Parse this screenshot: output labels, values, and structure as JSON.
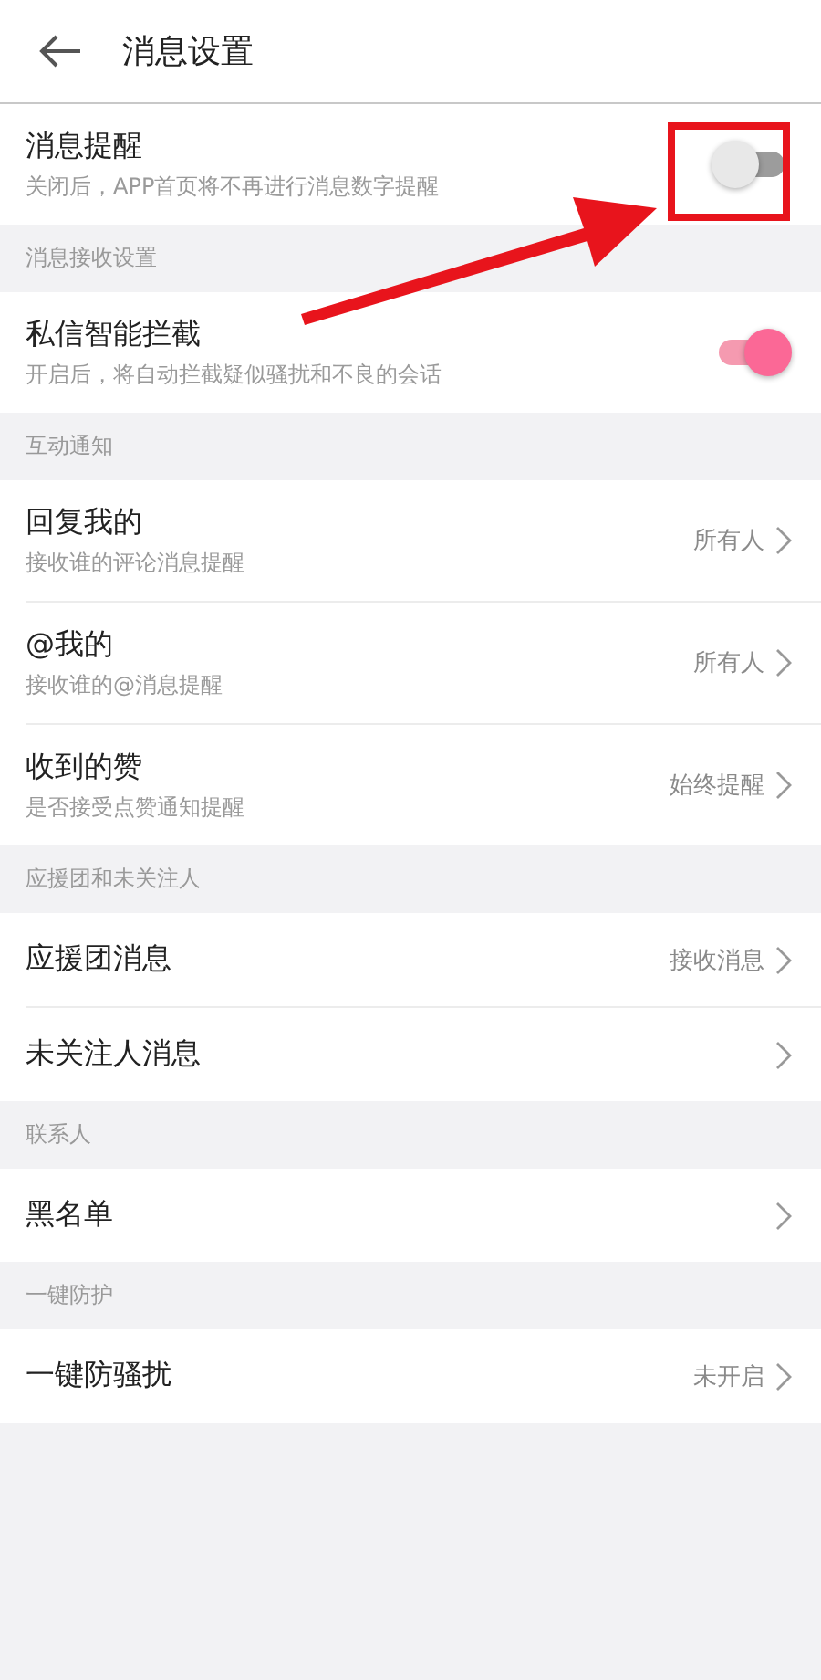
{
  "title": "消息设置",
  "sections": [
    {
      "items": [
        {
          "kind": "toggle",
          "title": "消息提醒",
          "subtitle": "关闭后，APP首页将不再进行消息数字提醒",
          "on": false
        }
      ]
    },
    {
      "header": "消息接收设置",
      "items": [
        {
          "kind": "toggle",
          "title": "私信智能拦截",
          "subtitle": "开启后，将自动拦截疑似骚扰和不良的会话",
          "on": true
        }
      ]
    },
    {
      "header": "互动通知",
      "items": [
        {
          "kind": "link",
          "title": "回复我的",
          "subtitle": "接收谁的评论消息提醒",
          "value": "所有人"
        },
        {
          "kind": "link",
          "title": "@我的",
          "subtitle": "接收谁的@消息提醒",
          "value": "所有人"
        },
        {
          "kind": "link",
          "title": "收到的赞",
          "subtitle": "是否接受点赞通知提醒",
          "value": "始终提醒"
        }
      ]
    },
    {
      "header": "应援团和未关注人",
      "items": [
        {
          "kind": "link",
          "title": "应援团消息",
          "value": "接收消息"
        },
        {
          "kind": "link",
          "title": "未关注人消息"
        }
      ]
    },
    {
      "header": "联系人",
      "items": [
        {
          "kind": "link",
          "title": "黑名单"
        }
      ]
    },
    {
      "header": "一键防护",
      "items": [
        {
          "kind": "link",
          "title": "一键防骚扰",
          "value": "未开启"
        }
      ]
    }
  ]
}
